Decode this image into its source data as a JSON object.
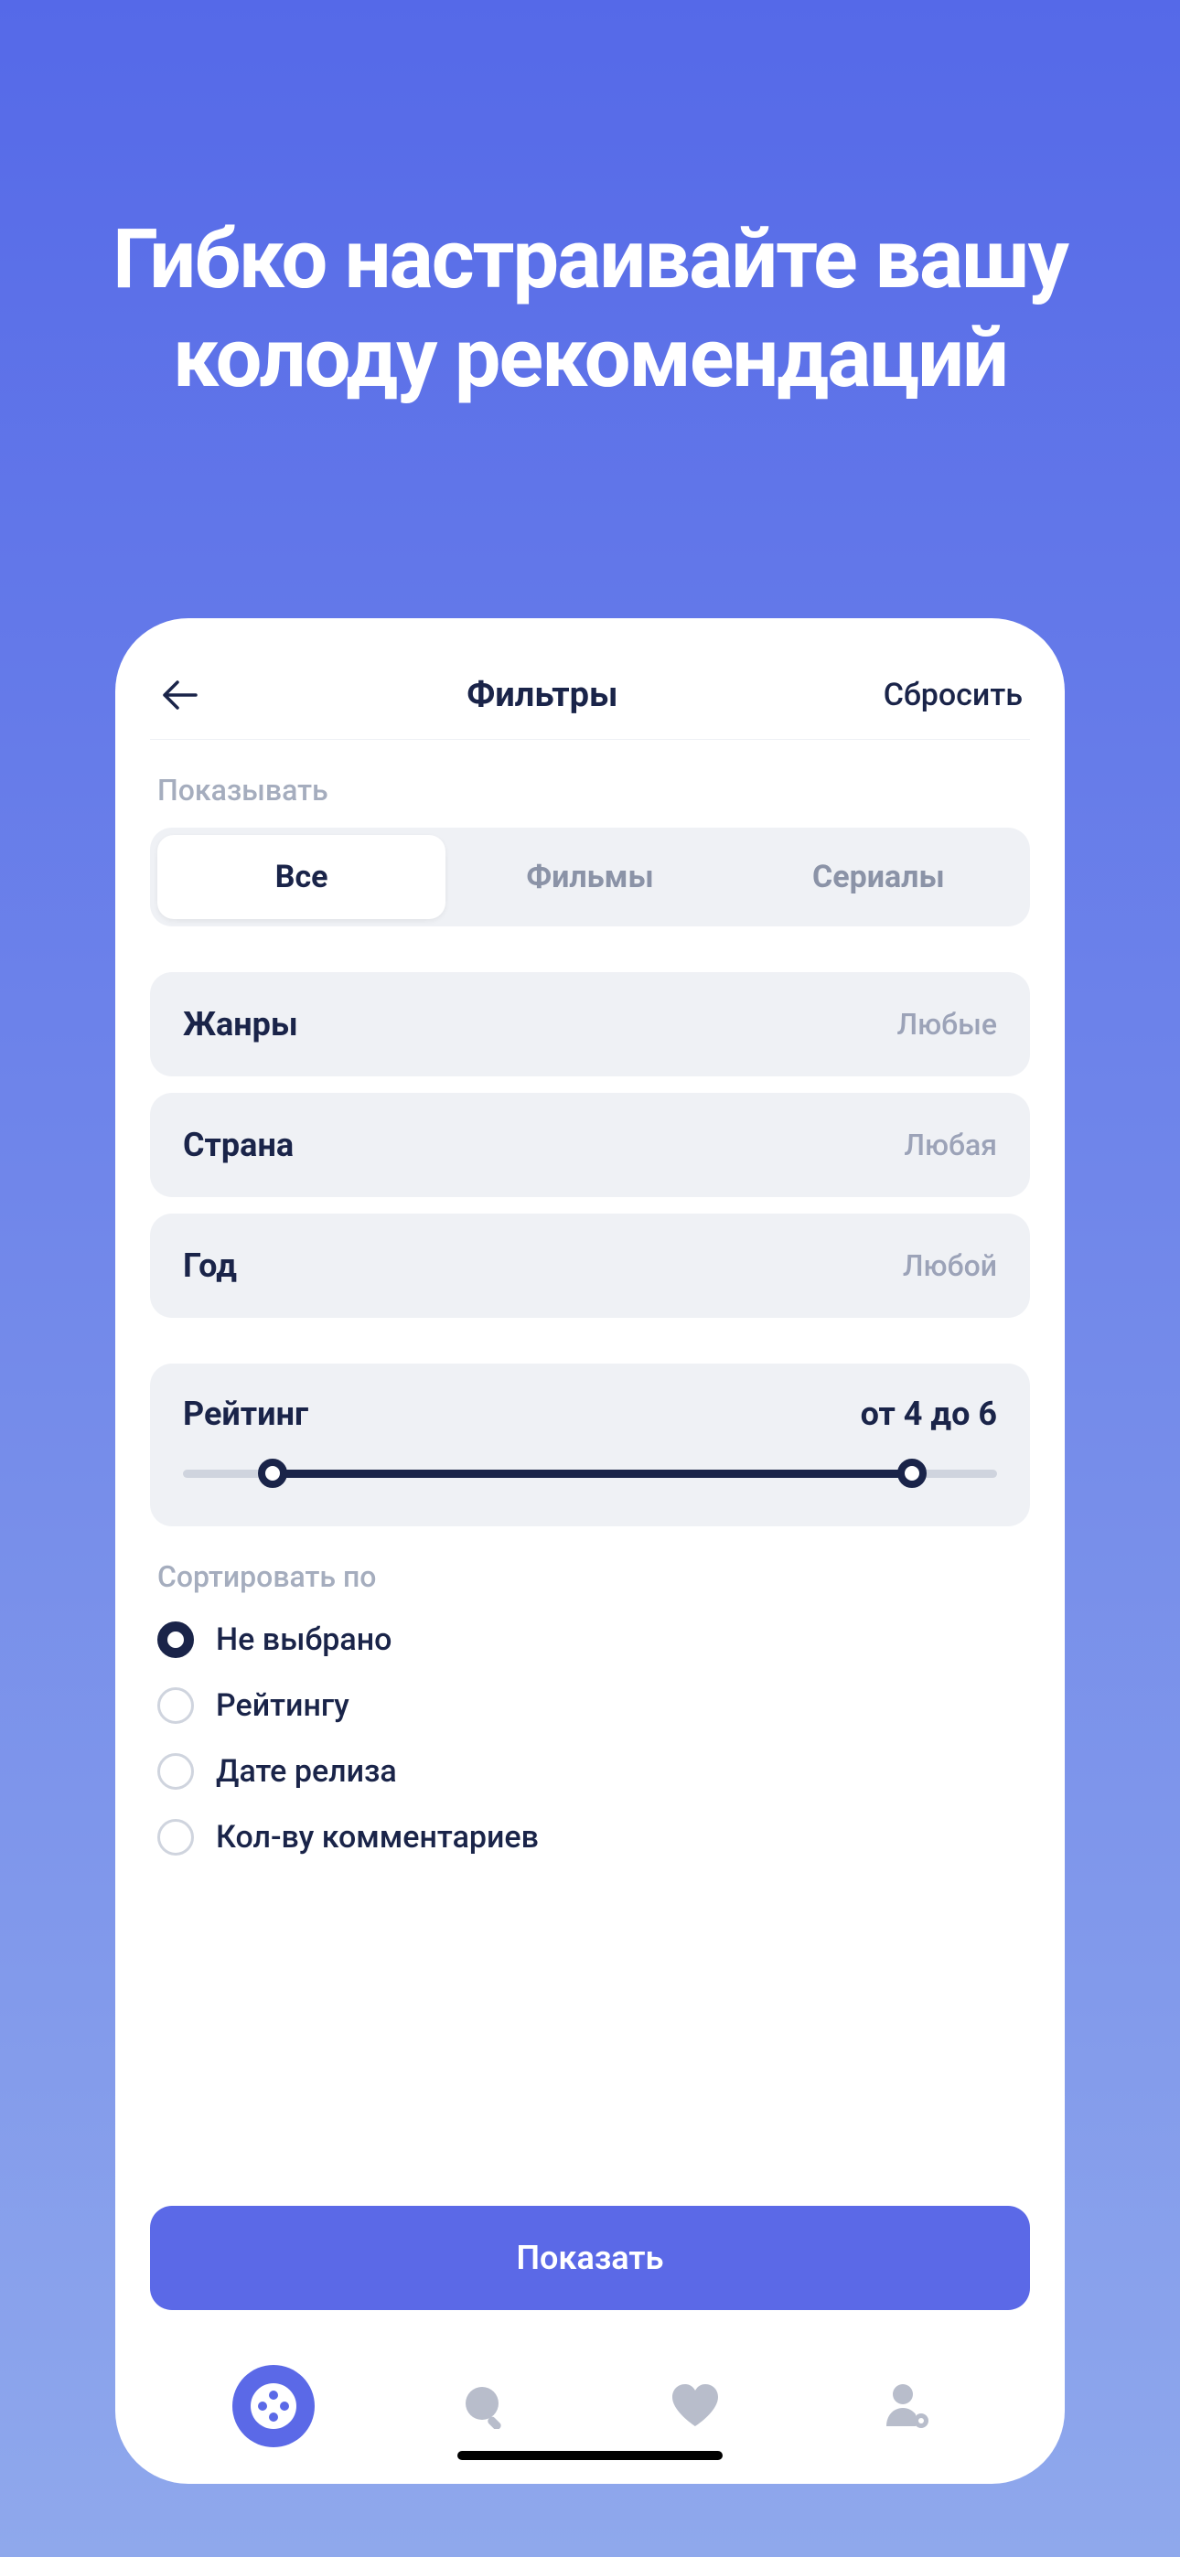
{
  "promo": {
    "title_line1": "Гибко настраивайте вашу",
    "title_line2": "колоду рекомендаций"
  },
  "header": {
    "title": "Фильтры",
    "reset": "Сбросить"
  },
  "show_section": {
    "label": "Показывать",
    "segments": [
      {
        "label": "Все",
        "active": true
      },
      {
        "label": "Фильмы",
        "active": false
      },
      {
        "label": "Сериалы",
        "active": false
      }
    ]
  },
  "filters": [
    {
      "label": "Жанры",
      "value": "Любые"
    },
    {
      "label": "Страна",
      "value": "Любая"
    },
    {
      "label": "Год",
      "value": "Любой"
    }
  ],
  "rating": {
    "label": "Рейтинг",
    "value_text": "от 4 до 6",
    "min": 4,
    "max": 6,
    "range_min": 0,
    "range_max": 10
  },
  "sort": {
    "label": "Сортировать по",
    "options": [
      {
        "label": "Не выбрано",
        "selected": true
      },
      {
        "label": "Рейтингу",
        "selected": false
      },
      {
        "label": "Дате релиза",
        "selected": false
      },
      {
        "label": "Кол-ву комментариев",
        "selected": false
      }
    ]
  },
  "apply_button": "Показать",
  "tabs": [
    {
      "name": "discover",
      "active": true
    },
    {
      "name": "search",
      "active": false
    },
    {
      "name": "favorites",
      "active": false
    },
    {
      "name": "profile",
      "active": false
    }
  ],
  "colors": {
    "accent": "#5B69E7",
    "dark_text": "#1A2449",
    "muted_text": "#9CA3B8",
    "card_bg": "#EFF1F5"
  }
}
